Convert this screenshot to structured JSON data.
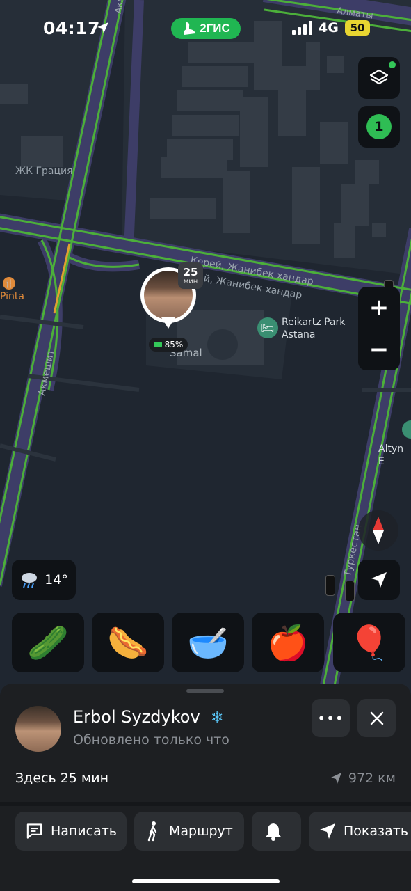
{
  "status_bar": {
    "time": "04:17",
    "network": "4G",
    "battery": "50",
    "app_logo": "2ГИС"
  },
  "map": {
    "labels": {
      "zhk": "ЖК Грация",
      "pinta": "Pinta",
      "kerey": "Керей, Жанибек хандар",
      "kerey2": "й, Жанибек хандар",
      "akmeshit_top": "Акмешит",
      "akmeshit_left": "Акмешит",
      "turkestan": "Туркестан",
      "almaty": "Алматы",
      "samal": "Samal",
      "altyn": "Altyn E",
      "reikartz": "Reikartz Park Astana"
    },
    "friends_count": "1",
    "user_pin": {
      "time_value": "25",
      "time_unit": "мин",
      "battery": "85%"
    },
    "weather": {
      "temp": "14°",
      "icon": "rain-cloud-icon"
    },
    "emoji_tiles": [
      "🥒",
      "🌭",
      "🥣",
      "🍎",
      "🎈"
    ]
  },
  "sheet": {
    "name": "Erbol Syzdykov",
    "badge": "❄",
    "status": "Обновлено только что",
    "here": "Здесь 25 мин",
    "distance": "972 км",
    "more_label": "•••",
    "actions": [
      "Написать",
      "Маршрут",
      "",
      "Показать"
    ]
  },
  "colors": {
    "accent": "#20b652",
    "traffic_green": "#4caf3a",
    "map_bg": "#1f2630",
    "sheet_bg": "#1d1f22"
  }
}
